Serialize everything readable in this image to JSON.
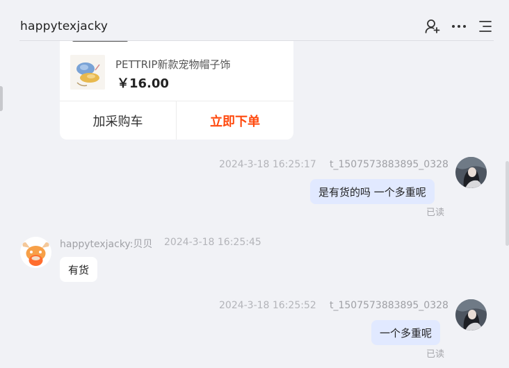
{
  "header": {
    "title": "happytexjacky",
    "icons": [
      "add-user-icon",
      "more-icon",
      "menu-icon"
    ]
  },
  "product_card": {
    "name": "PETTRIP新款宠物帽子饰",
    "price": "￥16.00",
    "add_cart_label": "加采购车",
    "buy_now_label": "立即下单",
    "buy_color": "#ff4a0f"
  },
  "messages": [
    {
      "side": "right",
      "timestamp": "2024-3-18 16:25:17",
      "sender": "t_1507573883895_0328",
      "text": "是有货的吗 一个多重呢",
      "status": "已读"
    },
    {
      "side": "left",
      "sender": "happytexjacky:贝贝",
      "timestamp": "2024-3-18 16:25:45",
      "text": "有货"
    },
    {
      "side": "right",
      "timestamp": "2024-3-18 16:25:52",
      "sender": "t_1507573883895_0328",
      "text": "一个多重呢",
      "status": "已读"
    }
  ],
  "colors": {
    "background": "#f1f2f6",
    "own_bubble": "#e1e9ff",
    "other_bubble": "#ffffff"
  }
}
